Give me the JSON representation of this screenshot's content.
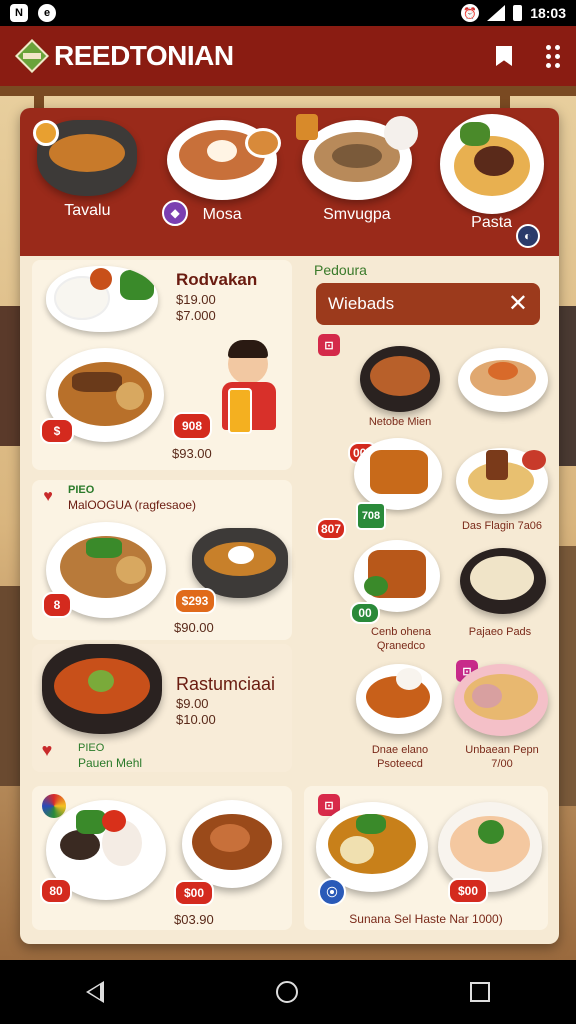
{
  "status_bar": {
    "time": "18:03",
    "icon_left_1": "N",
    "icon_left_2": "e"
  },
  "app_bar": {
    "title": "REEDTONIAN"
  },
  "categories": [
    {
      "label": "Tavalu"
    },
    {
      "label": "Mosa"
    },
    {
      "label": "Smvugpa"
    },
    {
      "label": "Pasta"
    }
  ],
  "panels": {
    "top_left": {
      "dish_name": "Rodvakan",
      "price_1": "$19.00",
      "price_2": "$7.000",
      "badge": "908",
      "price_3": "$93.00",
      "badge_small": "$"
    },
    "right_header": {
      "tag": "Pedoura",
      "search_value": "Wiebads"
    },
    "mid_left": {
      "tag": "PIEO",
      "dish_name": "MalOOGUA (ragfesaoe)",
      "badge": "$293",
      "price": "$90.00",
      "icon_badge": "8"
    },
    "mid_left_2": {
      "dish_name": "Rastumciaai",
      "price_1": "$9.00",
      "price_2": "$10.00",
      "tag": "PIEO",
      "sub_name": "Pauen Mehl"
    },
    "bottom_left": {
      "badge_1": "80",
      "badge_2": "$00",
      "price": "$03.90"
    },
    "right_grid": {
      "item_1_label": "Netobe Mien",
      "item_2_badge": "001",
      "item_3_badge": "807",
      "item_3_icon": "708",
      "item_4_label": "Das Flagin 7a06",
      "item_5_badge": "00",
      "item_5_label": "Cenb ohena",
      "item_5_sub": "Qranedco",
      "item_6_label": "Pajaeo Pads",
      "item_7_label": "Dnae elano",
      "item_7_sub": "Psoteecd",
      "item_8_label": "Unbaean Pepn",
      "item_8_sub": "7/00"
    },
    "bottom_right": {
      "badge": "$00",
      "caption": "Sunana Sel Haste Nar 1000)"
    }
  }
}
